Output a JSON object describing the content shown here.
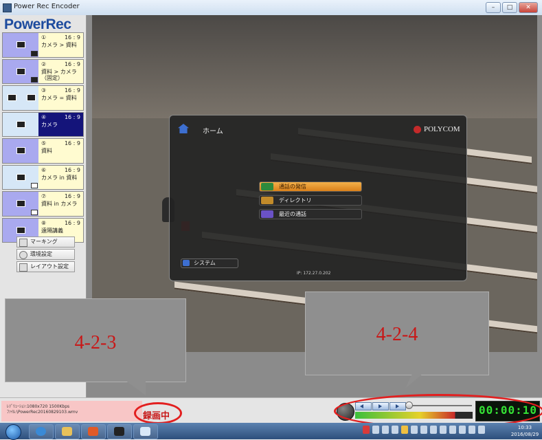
{
  "window": {
    "title": "Power Rec Encoder",
    "buttons": {
      "minimize": "–",
      "maximize": "□",
      "close": "✕"
    }
  },
  "sidebar": {
    "logo": "PowerRec",
    "presets": [
      {
        "num": "①",
        "ratio": "16 : 9",
        "label": "カメラ > 資料",
        "style": "normal"
      },
      {
        "num": "②",
        "ratio": "16 : 9",
        "label": "資料 > カメラ（固定）",
        "style": "normal"
      },
      {
        "num": "③",
        "ratio": "16 : 9",
        "label": "カメラ = 資料",
        "style": "normal"
      },
      {
        "num": "④",
        "ratio": "16 : 9",
        "label": "カメラ",
        "style": "active"
      },
      {
        "num": "⑤",
        "ratio": "16 : 9",
        "label": "資料",
        "style": "normal"
      },
      {
        "num": "⑥",
        "ratio": "16 : 9",
        "label": "カメラ in 資料",
        "style": "normal"
      },
      {
        "num": "⑦",
        "ratio": "16 : 9",
        "label": "資料 in カメラ",
        "style": "normal"
      },
      {
        "num": "⑧",
        "ratio": "16 : 9",
        "label": "遠隔講義",
        "style": "normal"
      }
    ],
    "buttons": {
      "marking": "マーキング",
      "env_settings": "環境設定",
      "layout_settings": "レイアウト設定"
    }
  },
  "video": {
    "menu": {
      "title": "ホーム",
      "brand": "POLYCOM",
      "items": [
        "通話の発信",
        "ディレクトリ",
        "最近の通話"
      ],
      "system": "システム",
      "ip": "IP: 172.27.0.202"
    }
  },
  "callouts": {
    "left": "4-2-3",
    "right": "4-2-4"
  },
  "status": {
    "resolution": "ﾚｿﾞﾘｭｰｼｮﾝ:1080x720 1500Kbps",
    "file": "ﾌｧｲﾙ:\\PowerRec20160829103.wmv",
    "recording": "録画中",
    "timer": "00:00:10",
    "level": 0.85
  },
  "taskbar": {
    "time": "10:33",
    "date": "2016/08/29"
  },
  "colors": {
    "accent_red": "#c81818",
    "logo_blue": "#1d4b9e",
    "active_preset": "#14147a",
    "timer_green": "#34e034"
  }
}
